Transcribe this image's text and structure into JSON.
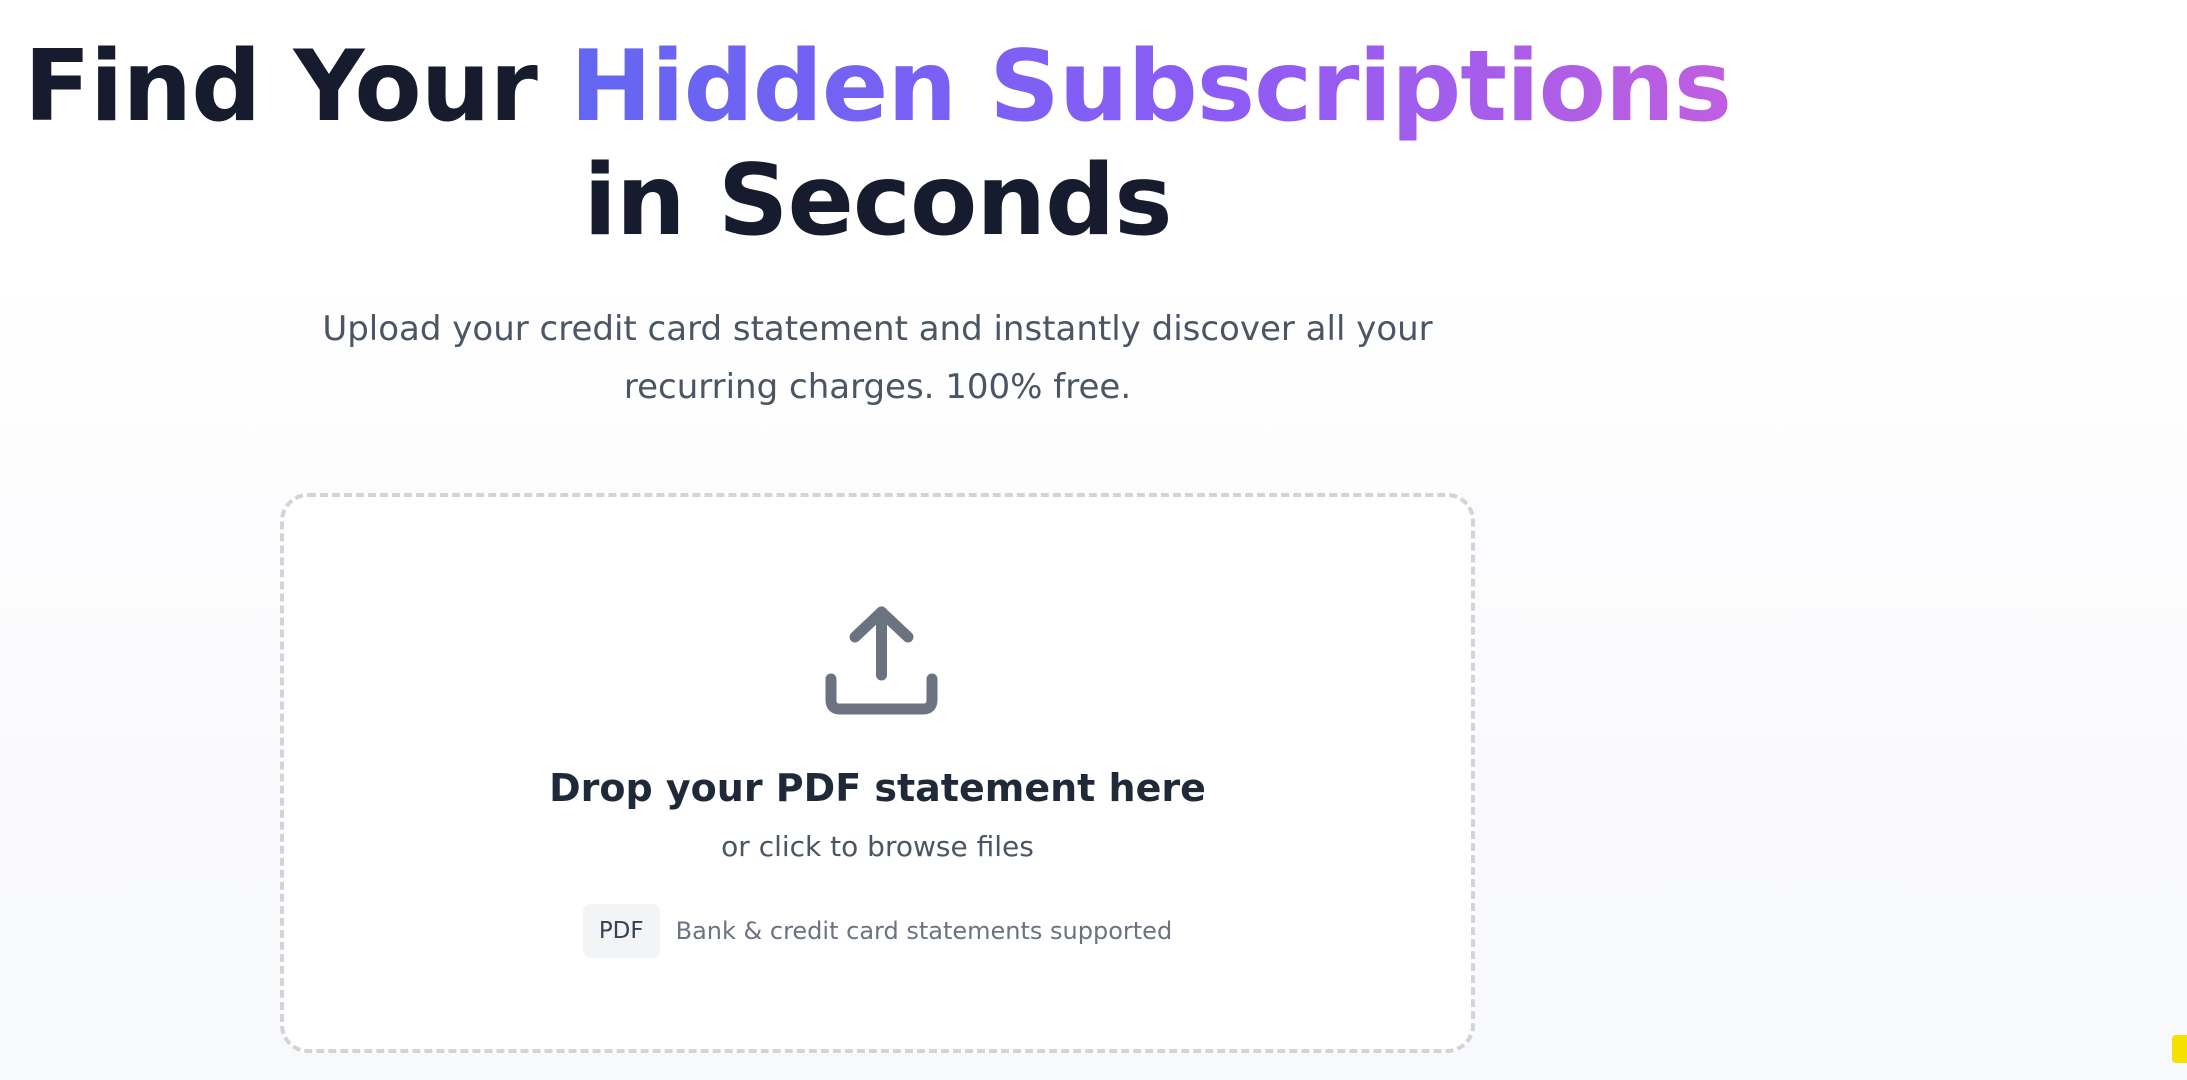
{
  "hero": {
    "headline_part1": "Find Your",
    "headline_highlight": "Hidden Subscriptions",
    "headline_part2": "in Seconds",
    "subtitle_line1": "Upload your credit card statement and instantly discover all your",
    "subtitle_line2": "recurring charges. 100% free.",
    "highlight_gradient": [
      "#6366f1",
      "#8b5cf6",
      "#c05ee0"
    ]
  },
  "upload": {
    "icon": "upload-icon",
    "title": "Drop your PDF statement here",
    "subtitle": "or click to browse files",
    "badge": "PDF",
    "supported_text": "Bank & credit card statements supported"
  },
  "colors": {
    "heading": "#161b2e",
    "body_text": "#4b5563",
    "dropzone_border": "#d4d4d8",
    "icon": "#6b7280",
    "corner_mark": "#f5e000"
  }
}
